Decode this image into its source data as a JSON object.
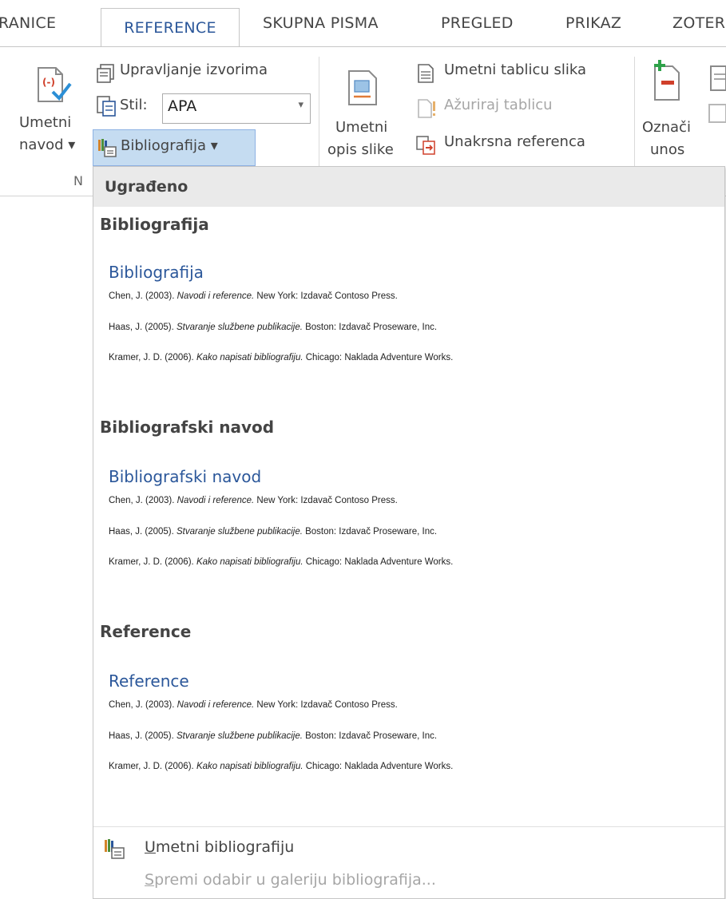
{
  "tabs": [
    {
      "label": "RANICE"
    },
    {
      "label": "REFERENCE"
    },
    {
      "label": "SKUPNA PISMA"
    },
    {
      "label": "PREGLED"
    },
    {
      "label": "PRIKAZ"
    },
    {
      "label": "ZOTER"
    }
  ],
  "ribbon": {
    "insert_citation": {
      "line1": "Umetni",
      "line2": "navod ▾"
    },
    "manage_sources": "Upravljanje izvorima",
    "style_label": "Stil:",
    "style_value": "APA",
    "bibliography_button": "Bibliografija ▾",
    "group_label_fragment": "N",
    "insert_caption": {
      "line1": "Umetni",
      "line2": "opis slike"
    },
    "insert_table_of_figures": "Umetni tablicu slika",
    "update_table": "Ažuriraj tablicu",
    "cross_reference": "Unakrsna referenca",
    "mark_entry": {
      "line1": "Označi",
      "line2": "unos"
    }
  },
  "menu": {
    "header": "Ugrađeno",
    "sections": [
      {
        "title": "Bibliografija",
        "gallery_title": "Bibliografija",
        "entries": [
          {
            "before": "Chen, J. (2003). ",
            "italic": "Navodi i reference.",
            "after": " New York: Izdavač Contoso Press."
          },
          {
            "before": "Haas, J. (2005). ",
            "italic": "Stvaranje službene publikacije.",
            "after": " Boston: Izdavač Proseware, Inc."
          },
          {
            "before": "Kramer, J. D. (2006). ",
            "italic": "Kako napisati bibliografiju.",
            "after": " Chicago: Naklada Adventure Works."
          }
        ]
      },
      {
        "title": "Bibliografski navod",
        "gallery_title": "Bibliografski navod",
        "entries": [
          {
            "before": "Chen, J. (2003). ",
            "italic": "Navodi i reference.",
            "after": " New York: Izdavač Contoso Press."
          },
          {
            "before": "Haas, J. (2005). ",
            "italic": "Stvaranje službene publikacije.",
            "after": " Boston: Izdavač Proseware, Inc."
          },
          {
            "before": "Kramer, J. D. (2006). ",
            "italic": "Kako napisati bibliografiju.",
            "after": " Chicago: Naklada Adventure Works."
          }
        ]
      },
      {
        "title": "Reference",
        "gallery_title": "Reference",
        "entries": [
          {
            "before": "Chen, J. (2003). ",
            "italic": "Navodi i reference.",
            "after": " New York: Izdavač Contoso Press."
          },
          {
            "before": "Haas, J. (2005). ",
            "italic": "Stvaranje službene publikacije.",
            "after": " Boston: Izdavač Proseware, Inc."
          },
          {
            "before": "Kramer, J. D. (2006). ",
            "italic": "Kako napisati bibliografiju.",
            "after": " Chicago: Naklada Adventure Works."
          }
        ]
      }
    ],
    "insert_bibliography": {
      "mnemonic": "U",
      "rest": "metni bibliografiju"
    },
    "save_selection": {
      "mnemonic": "S",
      "rest": "premi odabir u galeriju bibliografija..."
    }
  },
  "colors": {
    "accent": "#2b579a",
    "disabled": "#a6a6a6",
    "header_bg": "#eaeaea"
  }
}
